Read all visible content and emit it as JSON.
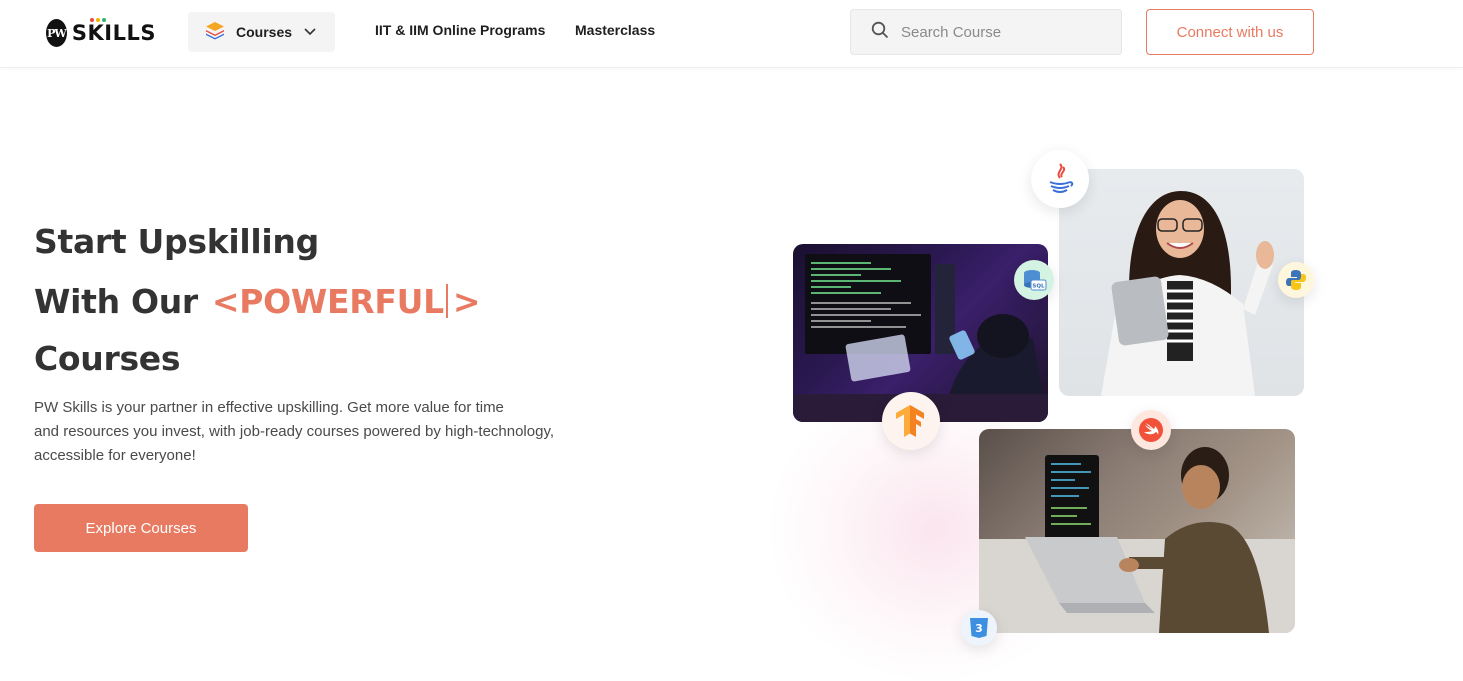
{
  "header": {
    "logo_text": "SKILLS",
    "logo_mark": "PW",
    "courses_label": "Courses",
    "nav": {
      "iit": "IIT & IIM Online Programs",
      "masterclass": "Masterclass"
    },
    "search_placeholder": "Search Course",
    "connect_label": "Connect with us"
  },
  "hero": {
    "line1": "Start Upskilling",
    "line2_prefix": "With Our",
    "line2_highlight_open": "<POWERFUL",
    "line2_highlight_close": ">",
    "line3": "Courses",
    "description_1": "PW Skills is your partner in effective upskilling. Get more value for time",
    "description_2": "and resources you invest, with job-ready courses powered by high-technology,",
    "description_3": "accessible for everyone!",
    "cta_label": "Explore Courses"
  },
  "icons": {
    "java": "java-icon",
    "sql": "sql-icon",
    "python": "python-icon",
    "tensorflow": "tensorflow-icon",
    "swift": "swift-icon",
    "css3": "css3-icon",
    "search": "search-icon",
    "courses": "layers-icon"
  },
  "colors": {
    "accent": "#e97a62",
    "text": "#333333"
  }
}
